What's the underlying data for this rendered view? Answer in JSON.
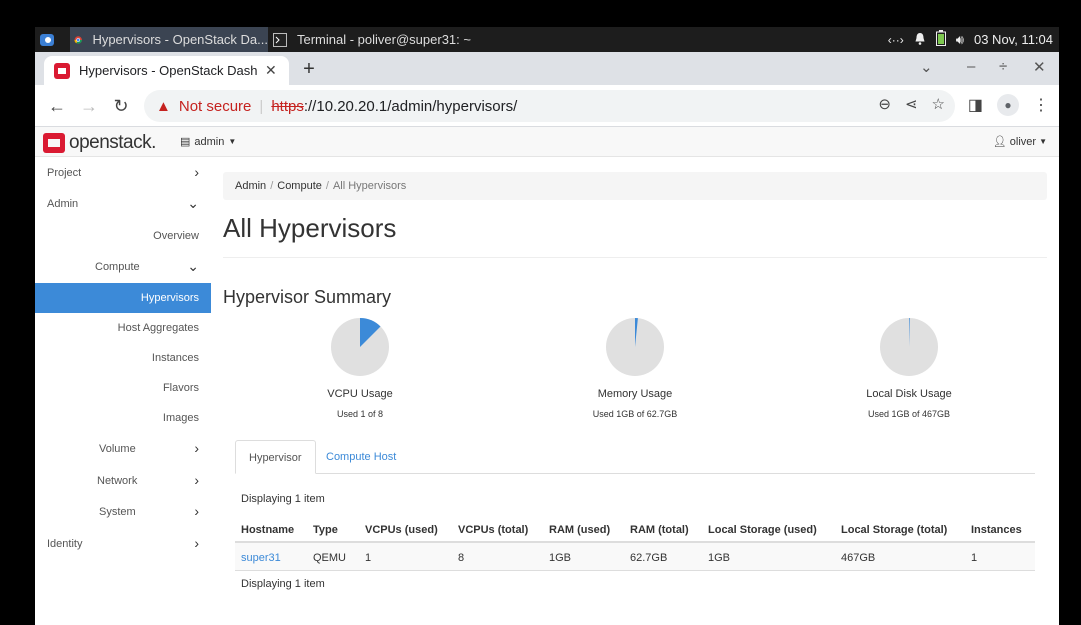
{
  "taskbar": {
    "tasks": [
      {
        "label": "Hypervisors - OpenStack Da..."
      },
      {
        "label": "Terminal - poliver@super31: ~"
      }
    ],
    "datetime": "03 Nov, 11:04"
  },
  "browser": {
    "tab_title": "Hypervisors - OpenStack Dash",
    "security_label": "Not secure",
    "url_scheme": "https",
    "url_rest": "://10.20.20.1/admin/hypervisors/"
  },
  "header": {
    "logo_text": "openstack.",
    "project": "admin",
    "user": "oliver"
  },
  "sidebar": {
    "items": [
      {
        "label": "Project"
      },
      {
        "label": "Admin"
      },
      {
        "label": "Overview"
      },
      {
        "label": "Compute"
      },
      {
        "label": "Hypervisors"
      },
      {
        "label": "Host Aggregates"
      },
      {
        "label": "Instances"
      },
      {
        "label": "Flavors"
      },
      {
        "label": "Images"
      },
      {
        "label": "Volume"
      },
      {
        "label": "Network"
      },
      {
        "label": "System"
      },
      {
        "label": "Identity"
      }
    ]
  },
  "breadcrumb": [
    "Admin",
    "Compute",
    "All Hypervisors"
  ],
  "page_title": "All Hypervisors",
  "summary": {
    "title": "Hypervisor Summary",
    "charts": [
      {
        "label": "VCPU Usage",
        "sub": "Used 1 of 8",
        "fraction": 0.125
      },
      {
        "label": "Memory Usage",
        "sub": "Used 1GB of 62.7GB",
        "fraction": 0.016
      },
      {
        "label": "Local Disk Usage",
        "sub": "Used 1GB of 467GB",
        "fraction": 0.002
      }
    ],
    "colors": {
      "used": "#3c8ad8",
      "free": "#e0e0e0"
    }
  },
  "tabs": [
    "Hypervisor",
    "Compute Host"
  ],
  "table": {
    "displaying": "Displaying 1 item",
    "headers": [
      "Hostname",
      "Type",
      "VCPUs (used)",
      "VCPUs (total)",
      "RAM (used)",
      "RAM (total)",
      "Local Storage (used)",
      "Local Storage (total)",
      "Instances"
    ],
    "rows": [
      [
        "super31",
        "QEMU",
        "1",
        "8",
        "1GB",
        "62.7GB",
        "1GB",
        "467GB",
        "1"
      ]
    ]
  }
}
